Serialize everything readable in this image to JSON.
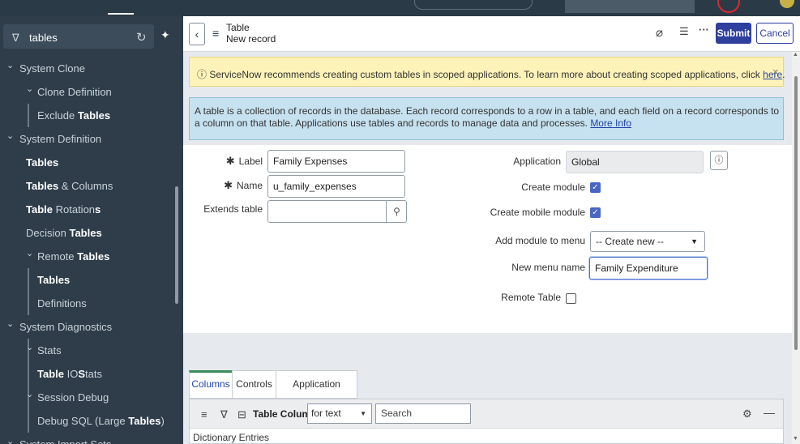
{
  "filter": {
    "value": "tables"
  },
  "sidebar": {
    "items": [
      {
        "pre": "System Clone",
        "bold": "",
        "post": "",
        "chevron": "⌄"
      },
      {
        "pre": "Clone Definition",
        "bold": "",
        "post": "",
        "chevron": "⌄"
      },
      {
        "pre": "Exclude ",
        "bold": "Tables",
        "post": "",
        "chevron": ""
      },
      {
        "pre": "System Definition",
        "bold": "",
        "post": "",
        "chevron": "⌄"
      },
      {
        "pre": "",
        "bold": "Tables",
        "post": "",
        "chevron": ""
      },
      {
        "pre": "",
        "bold": "Tables",
        "post": " & Columns",
        "chevron": ""
      },
      {
        "pre": "",
        "bold": "Table",
        "post": " Rotation",
        "post_bold": "s",
        "chevron": ""
      },
      {
        "pre": "Decision ",
        "bold": "Tables",
        "post": "",
        "chevron": ""
      },
      {
        "pre": "Remote ",
        "bold": "Tables",
        "post": "",
        "chevron": "⌄"
      },
      {
        "pre": "",
        "bold": "Tables",
        "post": "",
        "chevron": ""
      },
      {
        "pre": "Definitions",
        "bold": "",
        "post": "",
        "chevron": ""
      },
      {
        "pre": "System Diagnostics",
        "bold": "",
        "post": "",
        "chevron": "⌄"
      },
      {
        "pre": "Stats",
        "bold": "",
        "post": "",
        "chevron": "⌄"
      },
      {
        "pre": "",
        "bold": "Table",
        "post": " IO",
        "post_bold": "S",
        "post2": "tats",
        "chevron": ""
      },
      {
        "pre": "Session Debug",
        "bold": "",
        "post": "",
        "chevron": "⌄"
      },
      {
        "pre": "Debug SQL (Large ",
        "bold": "Tables",
        "post": ")",
        "chevron": ""
      },
      {
        "pre": "System Import Sets",
        "bold": "",
        "post": "",
        "chevron": "⌄"
      }
    ]
  },
  "header": {
    "title": "Table",
    "subtitle": "New record",
    "submit": "Submit",
    "cancel": "Cancel"
  },
  "warning": {
    "text": "ServiceNow recommends creating custom tables in scoped applications. To learn more about creating scoped applications, click ",
    "link": "here",
    "end": "."
  },
  "info": {
    "text": "A table is a collection of records in the database. Each record corresponds to a row in a table, and each field on a record corresponds to a column on that table. Applications use tables and records to manage data and processes. ",
    "link": "More Info"
  },
  "form": {
    "label_label": "Label",
    "label_value": "Family Expenses",
    "name_label": "Name",
    "name_value": "u_family_expenses",
    "extends_label": "Extends table",
    "extends_value": "",
    "application_label": "Application",
    "application_value": "Global",
    "create_module_label": "Create module",
    "create_module_checked": true,
    "create_mobile_label": "Create mobile module",
    "create_mobile_checked": true,
    "add_module_label": "Add module to menu",
    "add_module_value": "-- Create new --",
    "new_menu_label": "New menu name",
    "new_menu_value": "Family Expenditure",
    "remote_label": "Remote Table",
    "remote_checked": false
  },
  "tabs": [
    "Columns",
    "Controls",
    "Application Access"
  ],
  "list": {
    "title": "Table Columns",
    "filter_option": "for text",
    "search_placeholder": "Search",
    "dictionary": "Dictionary Entries"
  }
}
